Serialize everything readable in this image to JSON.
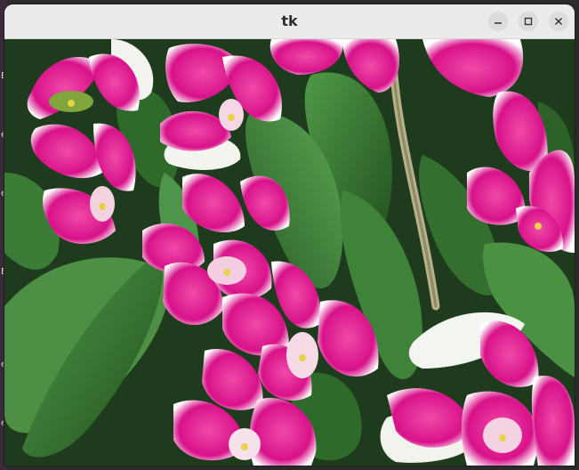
{
  "window": {
    "title": "tk"
  },
  "controls": {
    "minimize_icon": "minimize-icon",
    "maximize_icon": "maximize-icon",
    "close_icon": "close-icon"
  },
  "desktop": {
    "edge_chars": [
      "E",
      "e",
      "e",
      "E",
      "e",
      "e"
    ]
  },
  "colors": {
    "titlebar": "#ebebeb",
    "orchid_magenta": "#e0188f",
    "orchid_edge": "#ffffff",
    "leaf_green": "#3c7a38",
    "leaf_dark": "#1e3f1c"
  }
}
